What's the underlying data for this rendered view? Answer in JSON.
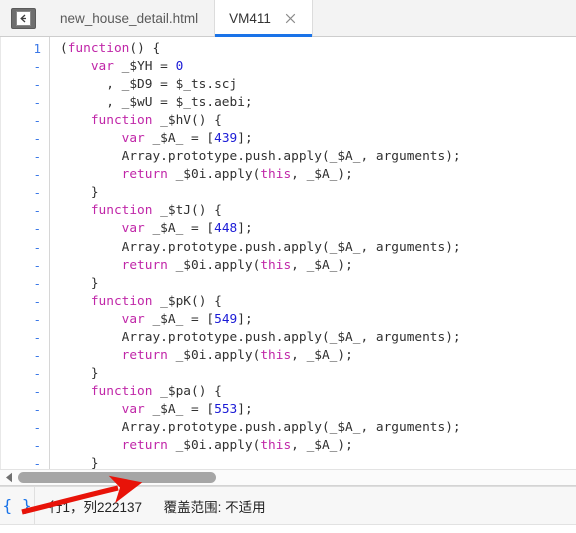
{
  "window": {
    "nav_button_label": "back-navigate",
    "background": "#ffffff"
  },
  "tabbar": {
    "background": "#f3f3f3",
    "active_accent": "#1a73e8",
    "tabs": [
      {
        "label": "new_house_detail.html",
        "active": false,
        "closable": false
      },
      {
        "label": "VM411",
        "active": true,
        "closable": true
      }
    ],
    "close_label": "×"
  },
  "editor": {
    "gutter": {
      "first_line_number": "1",
      "wrap_marker": "-"
    },
    "lines": [
      {
        "gutter": "1",
        "tokens": [
          {
            "t": "(",
            "c": "pl"
          },
          {
            "t": "function",
            "c": "kw"
          },
          {
            "t": "() {",
            "c": "pl"
          }
        ]
      },
      {
        "gutter": "-",
        "tokens": [
          {
            "t": "    ",
            "c": "pl"
          },
          {
            "t": "var",
            "c": "kw"
          },
          {
            "t": " _$YH = ",
            "c": "pl"
          },
          {
            "t": "0",
            "c": "num"
          }
        ]
      },
      {
        "gutter": "-",
        "tokens": [
          {
            "t": "      , _$D9 = $_ts.scj",
            "c": "pl"
          }
        ]
      },
      {
        "gutter": "-",
        "tokens": [
          {
            "t": "      , _$wU = $_ts.aebi;",
            "c": "pl"
          }
        ]
      },
      {
        "gutter": "-",
        "tokens": [
          {
            "t": "    ",
            "c": "pl"
          },
          {
            "t": "function",
            "c": "kw"
          },
          {
            "t": " _$hV() {",
            "c": "pl"
          }
        ]
      },
      {
        "gutter": "-",
        "tokens": [
          {
            "t": "        ",
            "c": "pl"
          },
          {
            "t": "var",
            "c": "kw"
          },
          {
            "t": " _$A_ = [",
            "c": "pl"
          },
          {
            "t": "439",
            "c": "num"
          },
          {
            "t": "];",
            "c": "pl"
          }
        ]
      },
      {
        "gutter": "-",
        "tokens": [
          {
            "t": "        Array.prototype.push.apply(_$A_, arguments);",
            "c": "pl"
          }
        ]
      },
      {
        "gutter": "-",
        "tokens": [
          {
            "t": "        ",
            "c": "pl"
          },
          {
            "t": "return",
            "c": "kw"
          },
          {
            "t": " _$0i.apply(",
            "c": "pl"
          },
          {
            "t": "this",
            "c": "kw"
          },
          {
            "t": ", _$A_);",
            "c": "pl"
          }
        ]
      },
      {
        "gutter": "-",
        "tokens": [
          {
            "t": "    }",
            "c": "pl"
          }
        ]
      },
      {
        "gutter": "-",
        "tokens": [
          {
            "t": "    ",
            "c": "pl"
          },
          {
            "t": "function",
            "c": "kw"
          },
          {
            "t": " _$tJ() {",
            "c": "pl"
          }
        ]
      },
      {
        "gutter": "-",
        "tokens": [
          {
            "t": "        ",
            "c": "pl"
          },
          {
            "t": "var",
            "c": "kw"
          },
          {
            "t": " _$A_ = [",
            "c": "pl"
          },
          {
            "t": "448",
            "c": "num"
          },
          {
            "t": "];",
            "c": "pl"
          }
        ]
      },
      {
        "gutter": "-",
        "tokens": [
          {
            "t": "        Array.prototype.push.apply(_$A_, arguments);",
            "c": "pl"
          }
        ]
      },
      {
        "gutter": "-",
        "tokens": [
          {
            "t": "        ",
            "c": "pl"
          },
          {
            "t": "return",
            "c": "kw"
          },
          {
            "t": " _$0i.apply(",
            "c": "pl"
          },
          {
            "t": "this",
            "c": "kw"
          },
          {
            "t": ", _$A_);",
            "c": "pl"
          }
        ]
      },
      {
        "gutter": "-",
        "tokens": [
          {
            "t": "    }",
            "c": "pl"
          }
        ]
      },
      {
        "gutter": "-",
        "tokens": [
          {
            "t": "    ",
            "c": "pl"
          },
          {
            "t": "function",
            "c": "kw"
          },
          {
            "t": " _$pK() {",
            "c": "pl"
          }
        ]
      },
      {
        "gutter": "-",
        "tokens": [
          {
            "t": "        ",
            "c": "pl"
          },
          {
            "t": "var",
            "c": "kw"
          },
          {
            "t": " _$A_ = [",
            "c": "pl"
          },
          {
            "t": "549",
            "c": "num"
          },
          {
            "t": "];",
            "c": "pl"
          }
        ]
      },
      {
        "gutter": "-",
        "tokens": [
          {
            "t": "        Array.prototype.push.apply(_$A_, arguments);",
            "c": "pl"
          }
        ]
      },
      {
        "gutter": "-",
        "tokens": [
          {
            "t": "        ",
            "c": "pl"
          },
          {
            "t": "return",
            "c": "kw"
          },
          {
            "t": " _$0i.apply(",
            "c": "pl"
          },
          {
            "t": "this",
            "c": "kw"
          },
          {
            "t": ", _$A_);",
            "c": "pl"
          }
        ]
      },
      {
        "gutter": "-",
        "tokens": [
          {
            "t": "    }",
            "c": "pl"
          }
        ]
      },
      {
        "gutter": "-",
        "tokens": [
          {
            "t": "    ",
            "c": "pl"
          },
          {
            "t": "function",
            "c": "kw"
          },
          {
            "t": " _$pa() {",
            "c": "pl"
          }
        ]
      },
      {
        "gutter": "-",
        "tokens": [
          {
            "t": "        ",
            "c": "pl"
          },
          {
            "t": "var",
            "c": "kw"
          },
          {
            "t": " _$A_ = [",
            "c": "pl"
          },
          {
            "t": "553",
            "c": "num"
          },
          {
            "t": "];",
            "c": "pl"
          }
        ]
      },
      {
        "gutter": "-",
        "tokens": [
          {
            "t": "        Array.prototype.push.apply(_$A_, arguments);",
            "c": "pl"
          }
        ]
      },
      {
        "gutter": "-",
        "tokens": [
          {
            "t": "        ",
            "c": "pl"
          },
          {
            "t": "return",
            "c": "kw"
          },
          {
            "t": " _$0i.apply(",
            "c": "pl"
          },
          {
            "t": "this",
            "c": "kw"
          },
          {
            "t": ", _$A_);",
            "c": "pl"
          }
        ]
      },
      {
        "gutter": "-",
        "tokens": [
          {
            "t": "    }",
            "c": "pl"
          }
        ]
      }
    ],
    "colors": {
      "keyword": "#c026a8",
      "number": "#1b1bd6",
      "plain": "#303030",
      "line_number": "#3b78e7"
    }
  },
  "scrollbar": {
    "orientation": "horizontal",
    "thumb_color": "#a6a6a6"
  },
  "statusbar": {
    "format_icon": "{ }",
    "cursor_position": "行1，列2221 37",
    "cursor_position_text": "行1，列222137",
    "coverage_label": "覆盖范围: 不适用",
    "background": "#f7f7f7",
    "icon_color": "#1a73e8"
  },
  "annotation": {
    "type": "arrow",
    "color": "#e81309",
    "description": "red-arrow-pointing-at-cursor-position"
  }
}
